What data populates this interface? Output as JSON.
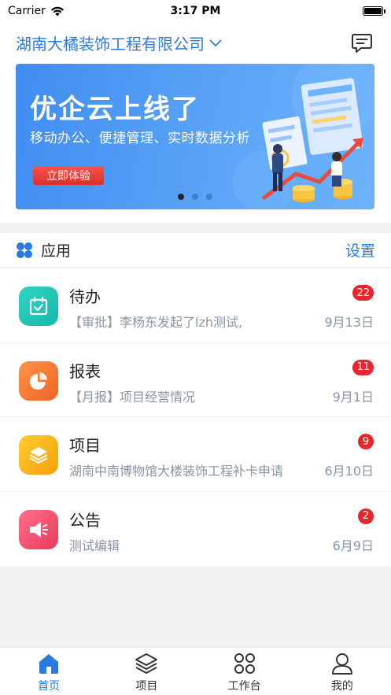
{
  "status_bar": {
    "carrier": "Carrier",
    "time": "3:17 PM"
  },
  "header": {
    "company": "湖南大橘装饰工程有限公司"
  },
  "banner": {
    "title": "优企云上线了",
    "subtitle": "移动办公、便捷管理、实时数据分析",
    "button_label": "立即体验",
    "active_slide": 1,
    "slide_count": 3
  },
  "apps": {
    "title": "应用",
    "settings_label": "设置",
    "items": [
      {
        "name": "待办",
        "desc": "【审批】李杨东发起了lzh测试,",
        "date": "9月13日",
        "badge": "22",
        "color": "#22c7b8",
        "icon": "calendar-check-icon"
      },
      {
        "name": "报表",
        "desc": "【月报】项目经营情况",
        "date": "9月1日",
        "badge": "11",
        "color": "#f47b35",
        "icon": "pie-chart-icon"
      },
      {
        "name": "项目",
        "desc": "湖南中南博物馆大楼装饰工程补卡申请",
        "date": "6月10日",
        "badge": "9",
        "color": "#f9b21b",
        "icon": "layers-icon"
      },
      {
        "name": "公告",
        "desc": "测试编辑",
        "date": "6月9日",
        "badge": "2",
        "color": "#f04d6c",
        "icon": "megaphone-icon"
      }
    ]
  },
  "tabbar": {
    "tabs": [
      {
        "label": "首页",
        "icon": "home-icon",
        "active": true
      },
      {
        "label": "项目",
        "icon": "layers-icon",
        "active": false
      },
      {
        "label": "工作台",
        "icon": "grid-icon",
        "active": false
      },
      {
        "label": "我的",
        "icon": "user-icon",
        "active": false
      }
    ]
  },
  "colors": {
    "accent": "#2a7be0",
    "badge": "#e8262e",
    "banner": "#4a94f2"
  }
}
